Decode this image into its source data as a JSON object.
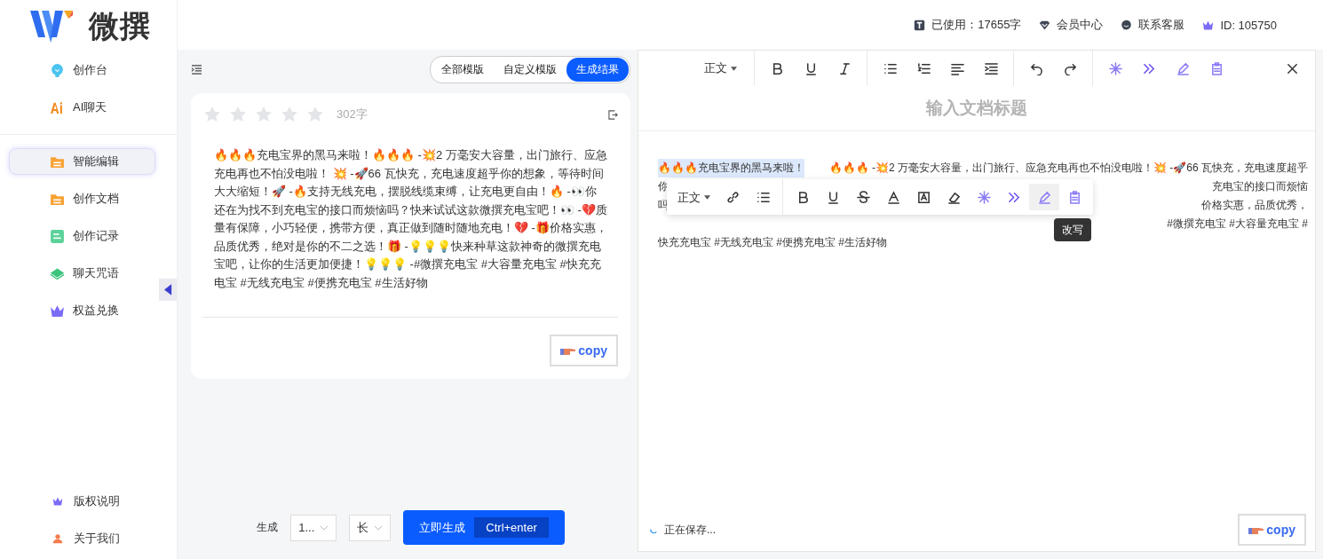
{
  "logo": {
    "text": "微撰"
  },
  "sidebar": {
    "items": [
      {
        "label": "创作台",
        "selected": false
      },
      {
        "label": "AI聊天",
        "selected": false
      },
      {
        "label": "智能编辑",
        "selected": true
      },
      {
        "label": "创作文档",
        "selected": false
      },
      {
        "label": "创作记录",
        "selected": false
      },
      {
        "label": "聊天咒语",
        "selected": false
      },
      {
        "label": "权益兑换",
        "selected": false
      }
    ],
    "footer_items": [
      {
        "label": "版权说明"
      },
      {
        "label": "关于我们"
      }
    ]
  },
  "header": {
    "stats": [
      {
        "text": "已使用：17655字"
      },
      {
        "text": "会员中心"
      },
      {
        "text": "联系客服"
      },
      {
        "text": "ID: 105750"
      }
    ]
  },
  "left_panel": {
    "tabs": [
      {
        "label": "全部模版",
        "selected": false
      },
      {
        "label": "自定义模版",
        "selected": false
      },
      {
        "label": "生成结果",
        "selected": true
      }
    ],
    "result": {
      "stars": 0,
      "word_count": "302字",
      "text": "🔥🔥🔥充电宝界的黑马来啦！🔥🔥🔥 -💥2 万毫安大容量，出门旅行、应急充电再也不怕没电啦！ 💥 -🚀66 瓦快充，充电速度超乎你的想象，等待时间大大缩短！🚀 -🔥支持无线充电，摆脱线缆束缚，让充电更自由！🔥 -👀你还在为找不到充电宝的接口而烦恼吗？快来试试这款微撰充电宝吧！👀 -💔质量有保障，小巧轻便，携带方便，真正做到随时随地充电！💔 -🎁价格实惠，品质优秀，绝对是你的不二之选！🎁 -💡💡💡快来种草这款神奇的微撰充电宝吧，让你的生活更加便捷！💡💡💡 -#微撰充电宝 #大容量充电宝 #快充充电宝 #无线充电宝 #便携充电宝 #生活好物",
      "copy_button": "copy"
    },
    "generate_bar": {
      "label": "生成",
      "count": "1...",
      "length": "长",
      "button": "立即生成",
      "shortcut": "Ctrl+enter"
    }
  },
  "editor": {
    "toolbar": {
      "style": "正文"
    },
    "title_placeholder": "输入文档标题",
    "lines": [
      {
        "left": "🔥🔥🔥充电宝界的黑马来啦！",
        "right": "🔥🔥🔥  -💥2 万毫安大容量，出门旅行、应急充电再也不怕没电啦！💥  -🚀66 瓦快充，充电速度超乎",
        "highlight": true
      },
      {
        "left": "你",
        "right": "充电宝的接口而烦恼"
      },
      {
        "left": "吗",
        "right": "价格实惠，品质优秀，"
      },
      {
        "right": "#微撰充电宝 #大容量充电宝 #"
      },
      {
        "left": "快充充电宝 #无线充电宝 #便携充电宝 #生活好物"
      }
    ],
    "floating_toolbar": {
      "style": "正文",
      "tooltip": "改写"
    },
    "status": "正在保存...",
    "copy_button": "copy"
  }
}
